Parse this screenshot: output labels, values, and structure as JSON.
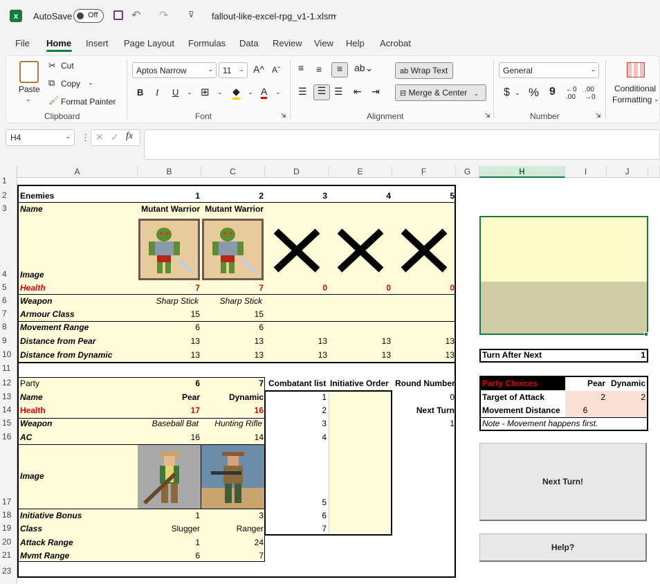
{
  "titlebar": {
    "autosave_label": "AutoSave",
    "autosave_state": "Off",
    "filename": "fallout-like-excel-rpg_v1-1.xlsm"
  },
  "menu": [
    "File",
    "Home",
    "Insert",
    "Page Layout",
    "Formulas",
    "Data",
    "Review",
    "View",
    "Help",
    "Acrobat"
  ],
  "ribbon": {
    "clipboard": {
      "paste": "Paste",
      "cut": "Cut",
      "copy": "Copy",
      "format_painter": "Format Painter",
      "label": "Clipboard"
    },
    "font": {
      "family": "Aptos Narrow",
      "size": "11",
      "bold": "B",
      "italic": "I",
      "underline": "U",
      "label": "Font"
    },
    "alignment": {
      "wrap": "Wrap Text",
      "merge": "Merge & Center",
      "label": "Alignment"
    },
    "number": {
      "format": "General",
      "currency": "$",
      "percent": "%",
      "comma": "9",
      "label": "Number"
    },
    "styles": {
      "conditional": "Conditional",
      "formatting": "Formatting"
    }
  },
  "formula": {
    "namebox": "H4",
    "fx": "fx",
    "value": ""
  },
  "columns": [
    "A",
    "B",
    "C",
    "D",
    "E",
    "F",
    "G",
    "H",
    "I",
    "J"
  ],
  "rows": [
    "1",
    "2",
    "3",
    "4",
    "5",
    "6",
    "7",
    "8",
    "9",
    "10",
    "11",
    "12",
    "13",
    "14",
    "15",
    "16",
    "17",
    "18",
    "19",
    "20",
    "21",
    "23"
  ],
  "enemies": {
    "header": "Enemies",
    "nums": [
      "1",
      "2",
      "3",
      "4",
      "5"
    ],
    "name_label": "Name",
    "names": [
      "Mutant Warrior",
      "Mutant Warrior"
    ],
    "image_label": "Image",
    "health_label": "Health",
    "health": [
      "7",
      "7",
      "0",
      "0",
      "0"
    ],
    "weapon_label": "Weapon",
    "weapons": [
      "Sharp Stick",
      "Sharp Stick"
    ],
    "armour_label": "Armour Class",
    "armour": [
      "15",
      "15"
    ],
    "movement_label": "Movement Range",
    "movement": [
      "6",
      "6"
    ],
    "dist_pear_label": "Distance from Pear",
    "dist_pear": [
      "13",
      "13",
      "13",
      "13",
      "13"
    ],
    "dist_dyn_label": "Distance from Dynamic",
    "dist_dyn": [
      "13",
      "13",
      "13",
      "13",
      "13"
    ]
  },
  "party": {
    "header": "Party",
    "nums": [
      "6",
      "7"
    ],
    "name_label": "Name",
    "names": [
      "Pear",
      "Dynamic"
    ],
    "health_label": "Health",
    "health": [
      "17",
      "16"
    ],
    "weapon_label": "Weapon",
    "weapons": [
      "Baseball Bat",
      "Hunting Rifle"
    ],
    "ac_label": "AC",
    "ac": [
      "16",
      "14"
    ],
    "image_label": "Image",
    "init_label": "Initiative Bonus",
    "init": [
      "1",
      "3"
    ],
    "class_label": "Class",
    "classes": [
      "Slugger",
      "Ranger"
    ],
    "attack_label": "Attack Range",
    "attack": [
      "1",
      "24"
    ],
    "mvmt_label": "Mvmt Range",
    "mvmt": [
      "6",
      "7"
    ]
  },
  "combat": {
    "combatant_header": "Combatant list",
    "initiative_header": "Initiative Order",
    "round_header": "Round Number",
    "combatants": [
      "1",
      "2",
      "3",
      "4",
      "5",
      "6",
      "7"
    ],
    "round_value": "0",
    "next_turn_label": "Next Turn",
    "next_turn_value": "1"
  },
  "turn_after_next": {
    "label": "Turn After Next",
    "value": "1"
  },
  "party_choices": {
    "header": "Party Choices",
    "col1": "Pear",
    "col2": "Dynamic",
    "target_label": "Target of Attack",
    "target": [
      "2",
      "2"
    ],
    "move_label": "Movement Distance",
    "move": [
      "6"
    ],
    "note": "Note - Movement happens first."
  },
  "buttons": {
    "next_turn": "Next Turn!",
    "help": "Help?"
  },
  "colors": {
    "excel_green": "#107c41",
    "cell_yellow": "#fffdd9",
    "health_red": "#e00000",
    "choice_pink": "#fbe0d6"
  }
}
